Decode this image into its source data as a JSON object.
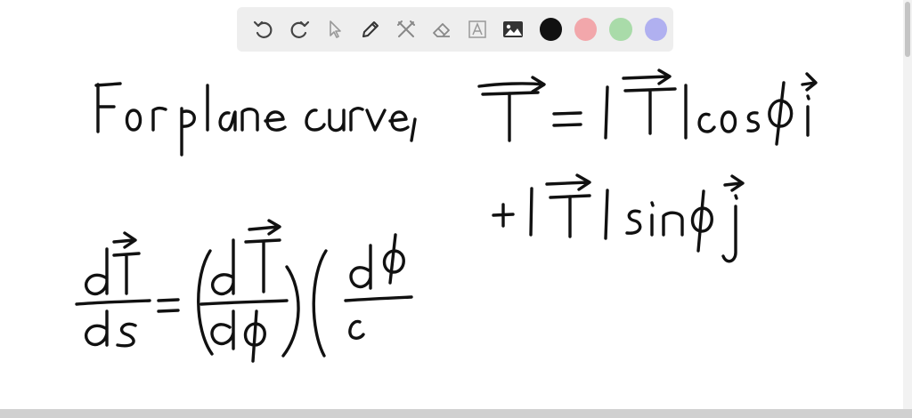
{
  "toolbar": {
    "tools": [
      {
        "name": "undo-icon"
      },
      {
        "name": "redo-icon"
      },
      {
        "name": "select-pointer-icon"
      },
      {
        "name": "pen-icon"
      },
      {
        "name": "tools-icon"
      },
      {
        "name": "eraser-icon"
      },
      {
        "name": "text-tool-icon"
      },
      {
        "name": "image-icon"
      }
    ],
    "colors": [
      "#111111",
      "#f2a7ab",
      "#a9dba9",
      "#b0b0f0"
    ],
    "selected_color": "#111111"
  },
  "whiteboard": {
    "line1_left": "For plane curve,",
    "line1_right": "T = |T| cos φ i",
    "line2_right": "+ |T| sin φ j",
    "line3": "dT/ds = (dT/dφ)(dφ/c"
  }
}
